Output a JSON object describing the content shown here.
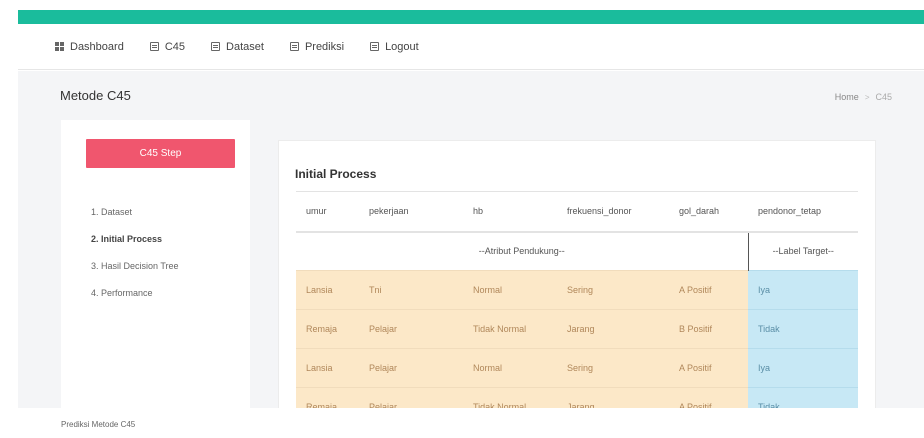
{
  "nav": {
    "items": [
      {
        "label": "Dashboard",
        "icon": "grid-icon"
      },
      {
        "label": "C45",
        "icon": "doc-icon"
      },
      {
        "label": "Dataset",
        "icon": "doc-icon"
      },
      {
        "label": "Prediksi",
        "icon": "doc-icon"
      },
      {
        "label": "Logout",
        "icon": "doc-icon"
      }
    ]
  },
  "page": {
    "title": "Metode C45",
    "breadcrumb": {
      "home": "Home",
      "separator": ">",
      "current": "C45"
    }
  },
  "sidebar": {
    "button_label": "C45 Step",
    "steps": [
      {
        "label": "1. Dataset",
        "active": false
      },
      {
        "label": "2. Initial Process",
        "active": true
      },
      {
        "label": "3. Hasil Decision Tree",
        "active": false
      },
      {
        "label": "4. Performance",
        "active": false
      }
    ]
  },
  "main": {
    "title": "Initial Process",
    "table": {
      "columns": [
        "umur",
        "pekerjaan",
        "hb",
        "frekuensi_donor",
        "gol_darah",
        "pendonor_tetap"
      ],
      "group_attr": "--Atribut Pendukung--",
      "group_target": "--Label Target--",
      "rows": [
        [
          "Lansia",
          "Tni",
          "Normal",
          "Sering",
          "A Positif",
          "Iya"
        ],
        [
          "Remaja",
          "Pelajar",
          "Tidak Normal",
          "Jarang",
          "B Positif",
          "Tidak"
        ],
        [
          "Lansia",
          "Pelajar",
          "Normal",
          "Sering",
          "A Positif",
          "Iya"
        ],
        [
          "Remaja",
          "Pelajar",
          "Tidak Normal",
          "Jarang",
          "A Positif",
          "Tidak"
        ]
      ]
    }
  },
  "footer": {
    "text": "Prediksi Metode C45"
  },
  "colors": {
    "topbar": "#1abc9c",
    "step_button": "#f0566e",
    "attr_cell": "#fce8c8",
    "target_cell": "#c7e8f5"
  }
}
